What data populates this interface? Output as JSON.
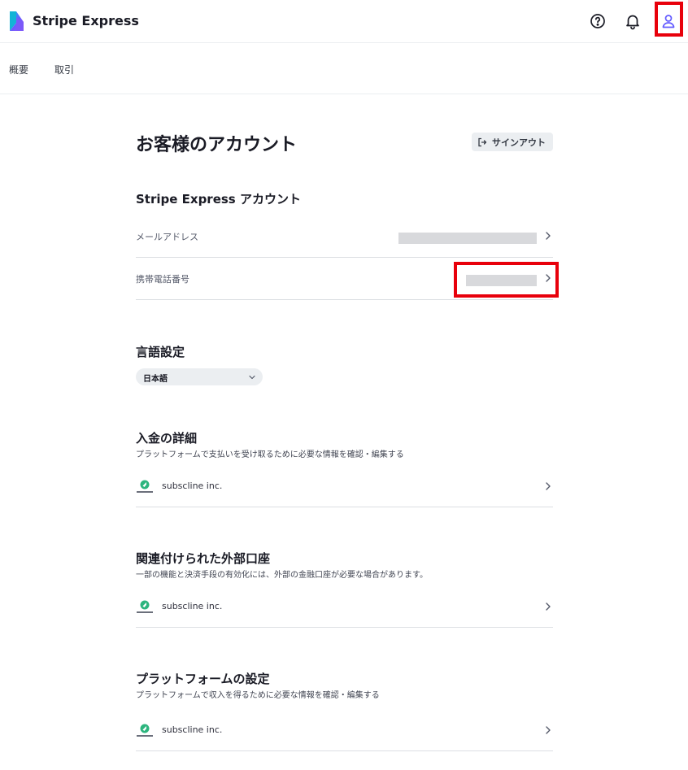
{
  "header": {
    "brand": "Stripe Express",
    "help_icon": "help-circle-icon",
    "notification_icon": "bell-icon",
    "account_icon": "user-icon",
    "accent_color": "#635bff",
    "highlight_color": "#e8000b"
  },
  "nav": {
    "items": [
      "概要",
      "取引"
    ]
  },
  "page": {
    "title": "お客様のアカウント",
    "signout_label": "サインアウト"
  },
  "express_account": {
    "title": "Stripe Express アカウント",
    "rows": [
      {
        "label": "メールアドレス",
        "value_redacted": true
      },
      {
        "label": "携帯電話番号",
        "value_redacted": true
      }
    ]
  },
  "language": {
    "title": "言語設定",
    "selected": "日本語"
  },
  "payout_details": {
    "title": "入金の詳細",
    "description": "プラットフォームで支払いを受け取るために必要な情報を確認・編集する",
    "business_name": "subscline inc."
  },
  "external_accounts": {
    "title": "関連付けられた外部口座",
    "description": "一部の機能と決済手段の有効化には、外部の金融口座が必要な場合があります。",
    "business_name": "subscline inc."
  },
  "platform_settings": {
    "title": "プラットフォームの設定",
    "description": "プラットフォームで収入を得るために必要な情報を確認・編集する",
    "business_name": "subscline inc."
  }
}
